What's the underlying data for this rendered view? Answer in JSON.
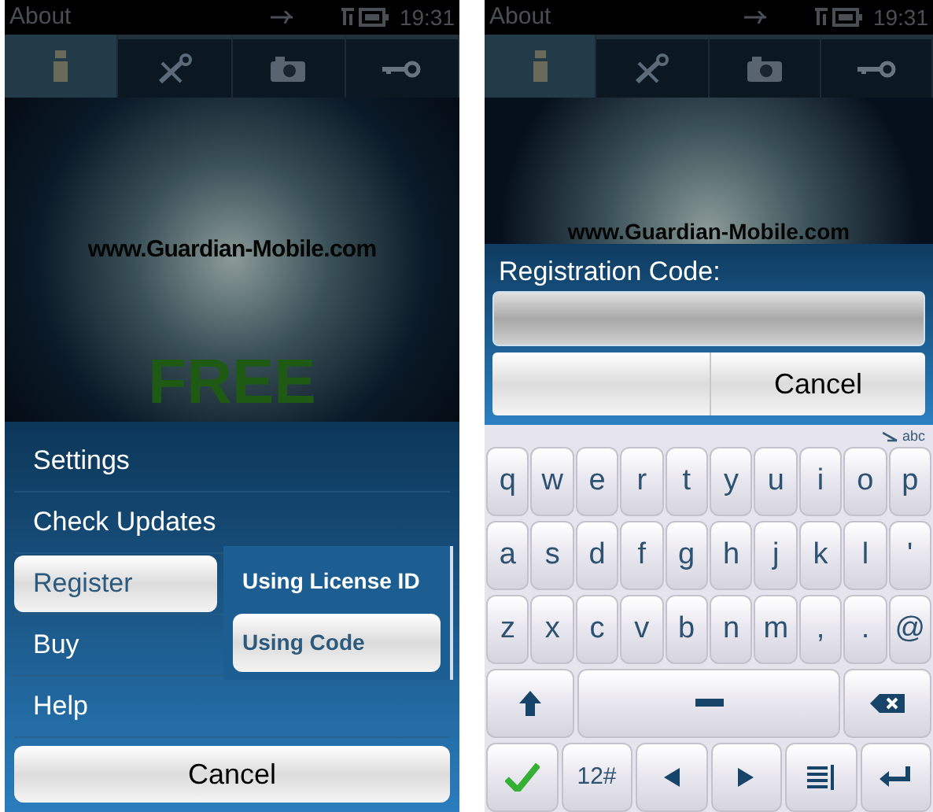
{
  "left_screen": {
    "status_bar": {
      "title": "About",
      "time": "19:31"
    },
    "tabs": [
      {
        "selected": true
      },
      {
        "selected": false
      },
      {
        "selected": false
      },
      {
        "selected": false
      }
    ],
    "banner": {
      "url": "www.Guardian-Mobile.com",
      "badge": "FREE"
    },
    "menu": {
      "items": [
        {
          "label": "Settings",
          "selected": false
        },
        {
          "label": "Check Updates",
          "selected": false
        },
        {
          "label": "Register",
          "selected": true,
          "submenu": [
            {
              "label": "Using License ID",
              "selected": false
            },
            {
              "label": "Using Code",
              "selected": true
            }
          ]
        },
        {
          "label": "Buy",
          "selected": false
        },
        {
          "label": "Help",
          "selected": false
        }
      ],
      "cancel": "Cancel"
    }
  },
  "right_screen": {
    "status_bar": {
      "title": "About",
      "time": "19:31"
    },
    "tabs": [
      {
        "selected": true
      },
      {
        "selected": false
      },
      {
        "selected": false
      },
      {
        "selected": false
      }
    ],
    "banner": {
      "url": "www.Guardian-Mobile.com"
    },
    "dialog": {
      "label": "Registration Code:",
      "cancel": "Cancel"
    },
    "keyboard": {
      "mode": "abc",
      "rows": [
        [
          "q",
          "w",
          "e",
          "r",
          "t",
          "y",
          "u",
          "i",
          "o",
          "p"
        ],
        [
          "a",
          "s",
          "d",
          "f",
          "g",
          "h",
          "j",
          "k",
          "l",
          "'"
        ],
        [
          "z",
          "x",
          "c",
          "v",
          "b",
          "n",
          "m",
          ",",
          ".",
          "@"
        ]
      ],
      "symbols_key": "12#"
    }
  }
}
